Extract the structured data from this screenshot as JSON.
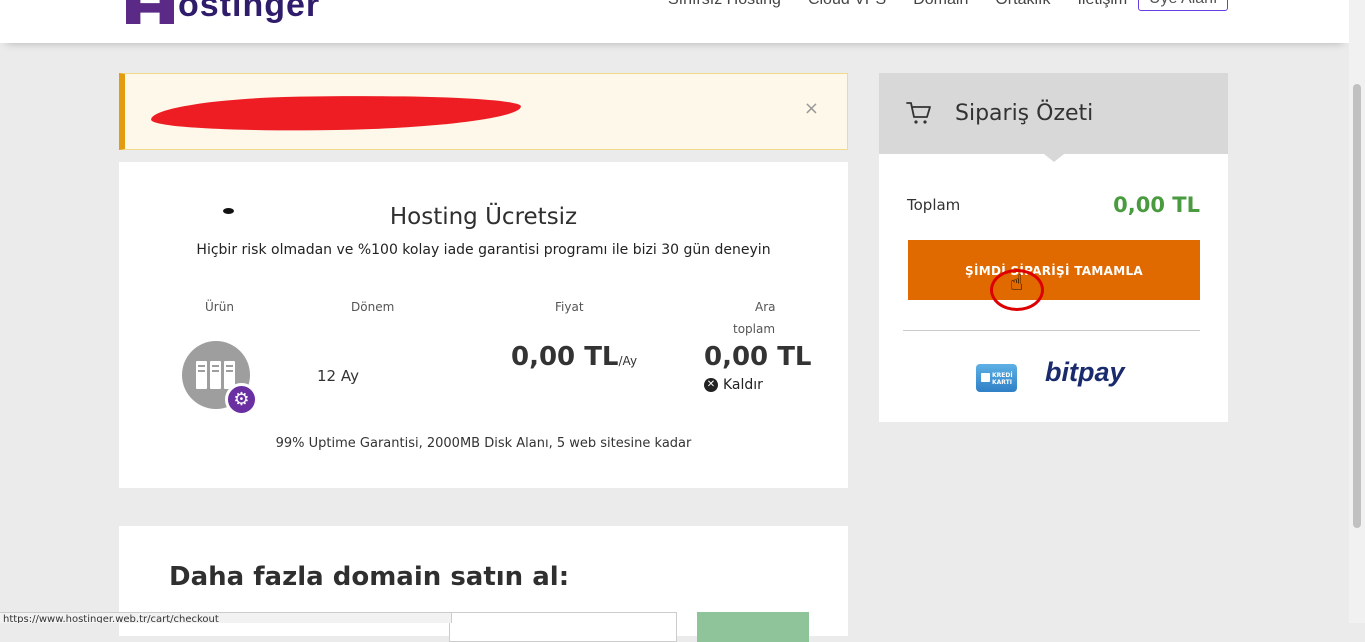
{
  "header": {
    "logo_text": "ostinger",
    "nav": [
      "Sınırsız Hosting",
      "Cloud VPS",
      "Domain",
      "Ortaklık",
      "İletişim"
    ],
    "member_button": "Üye Alanı"
  },
  "alert": {
    "close_glyph": "×"
  },
  "product": {
    "title": "Hosting Ücretsiz",
    "subtitle": "Hiçbir risk olmadan ve %100 kolay iade garantisi programı ile bizi 30 gün deneyin",
    "columns": {
      "product": "Ürün",
      "period": "Dönem",
      "price": "Fiyat",
      "subtotal_line1": "Ara",
      "subtotal_line2": "toplam"
    },
    "period_value": "12 Ay",
    "price_value": "0,00 TL",
    "price_unit": "/Ay",
    "subtotal_value": "0,00 TL",
    "remove_label": "Kaldır",
    "features": "99% Uptime Garantisi, 2000MB Disk Alanı, 5 web sitesine kadar"
  },
  "domain": {
    "title": "Daha fazla domain satın al:"
  },
  "statusbar": {
    "url": "https://www.hostinger.web.tr/cart/checkout"
  },
  "summary": {
    "title": "Sipariş Özeti",
    "total_label": "Toplam",
    "total_value": "0,00 TL",
    "complete_button": "ŞİMDİ SİPARİŞİ TAMAMLA",
    "card_logo_text": "KREDİ KARTI",
    "bitpay": "bitpay"
  },
  "colors": {
    "accent_orange": "#e06a00",
    "total_green": "#4a9b3f",
    "brand_purple": "#673de6",
    "alert_border": "#e39b10"
  }
}
